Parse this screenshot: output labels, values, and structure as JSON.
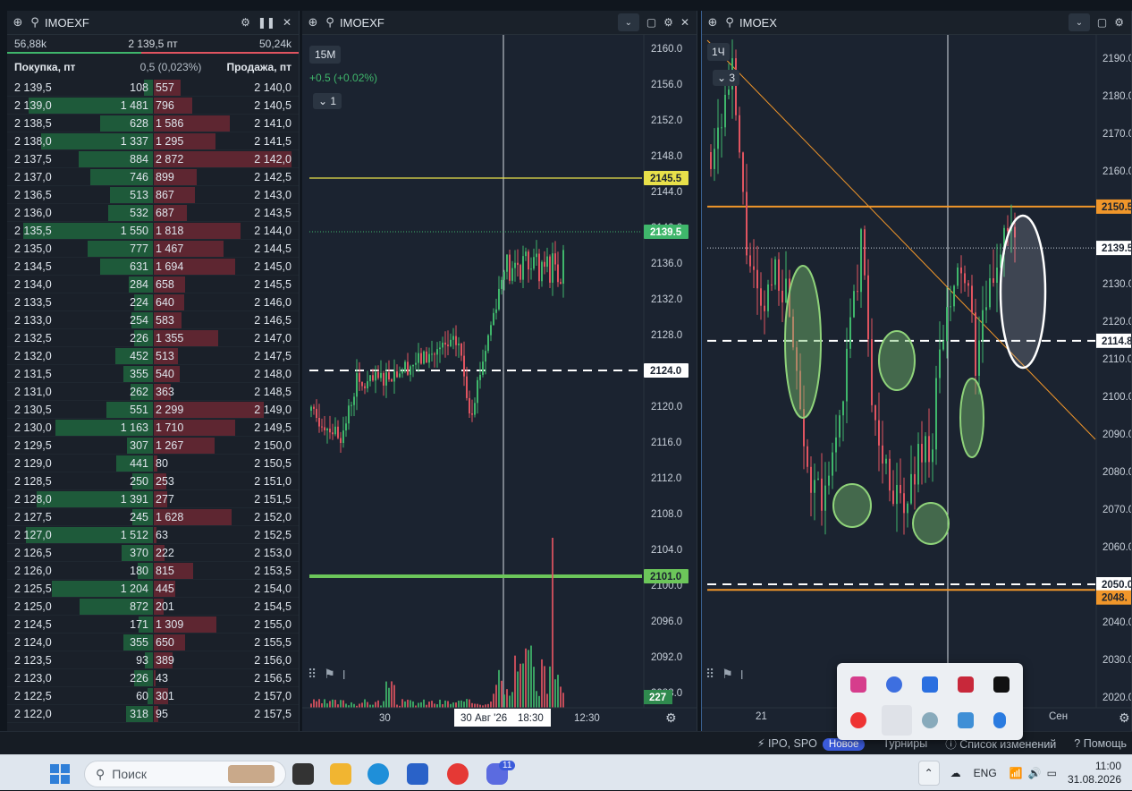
{
  "orderbook": {
    "symbol": "IMOEXF",
    "buy_volume": "56,88k",
    "mid_price": "2 139,5 пт",
    "sell_volume": "50,24k",
    "buy_header": "Покупка, пт",
    "spread": "0,5 (0,023%)",
    "sell_header": "Продажа, пт",
    "rows": [
      [
        "2 139,5",
        "108",
        "557",
        "2 140,0"
      ],
      [
        "2 139,0",
        "1 481",
        "796",
        "2 140,5"
      ],
      [
        "2 138,5",
        "628",
        "1 586",
        "2 141,0"
      ],
      [
        "2 138,0",
        "1 337",
        "1 295",
        "2 141,5"
      ],
      [
        "2 137,5",
        "884",
        "2 872",
        "2 142,0"
      ],
      [
        "2 137,0",
        "746",
        "899",
        "2 142,5"
      ],
      [
        "2 136,5",
        "513",
        "867",
        "2 143,0"
      ],
      [
        "2 136,0",
        "532",
        "687",
        "2 143,5"
      ],
      [
        "2 135,5",
        "1 550",
        "1 818",
        "2 144,0"
      ],
      [
        "2 135,0",
        "777",
        "1 467",
        "2 144,5"
      ],
      [
        "2 134,5",
        "631",
        "1 694",
        "2 145,0"
      ],
      [
        "2 134,0",
        "284",
        "658",
        "2 145,5"
      ],
      [
        "2 133,5",
        "224",
        "640",
        "2 146,0"
      ],
      [
        "2 133,0",
        "254",
        "583",
        "2 146,5"
      ],
      [
        "2 132,5",
        "226",
        "1 355",
        "2 147,0"
      ],
      [
        "2 132,0",
        "452",
        "513",
        "2 147,5"
      ],
      [
        "2 131,5",
        "355",
        "540",
        "2 148,0"
      ],
      [
        "2 131,0",
        "262",
        "363",
        "2 148,5"
      ],
      [
        "2 130,5",
        "551",
        "2 299",
        "2 149,0"
      ],
      [
        "2 130,0",
        "1 163",
        "1 710",
        "2 149,5"
      ],
      [
        "2 129,5",
        "307",
        "1 267",
        "2 150,0"
      ],
      [
        "2 129,0",
        "441",
        "80",
        "2 150,5"
      ],
      [
        "2 128,5",
        "250",
        "253",
        "2 151,0"
      ],
      [
        "2 128,0",
        "1 391",
        "277",
        "2 151,5"
      ],
      [
        "2 127,5",
        "245",
        "1 628",
        "2 152,0"
      ],
      [
        "2 127,0",
        "1 512",
        "63",
        "2 152,5"
      ],
      [
        "2 126,5",
        "370",
        "222",
        "2 153,0"
      ],
      [
        "2 126,0",
        "180",
        "815",
        "2 153,5"
      ],
      [
        "2 125,5",
        "1 204",
        "445",
        "2 154,0"
      ],
      [
        "2 125,0",
        "872",
        "201",
        "2 154,5"
      ],
      [
        "2 124,5",
        "171",
        "1 309",
        "2 155,0"
      ],
      [
        "2 124,0",
        "355",
        "650",
        "2 155,5"
      ],
      [
        "2 123,5",
        "93",
        "389",
        "2 156,0"
      ],
      [
        "2 123,0",
        "226",
        "43",
        "2 156,5"
      ],
      [
        "2 122,5",
        "60",
        "301",
        "2 157,0"
      ],
      [
        "2 122,0",
        "318",
        "95",
        "2 157,5"
      ]
    ]
  },
  "chart1": {
    "symbol": "IMOEXF",
    "timeframe": "15М",
    "change": "+0.5 (+0.02%)",
    "layers": "1",
    "y_ticks": [
      "2160.0",
      "2156.0",
      "2152.0",
      "2148.0",
      "2144.0",
      "2140.0",
      "2136.0",
      "2132.0",
      "2128.0",
      "2124.0",
      "2120.0",
      "2116.0",
      "2112.0",
      "2108.0",
      "2104.0",
      "2100.0",
      "2096.0",
      "2092.0",
      "2088.0"
    ],
    "marker_yellow": "2145.5",
    "marker_last": "2139.5",
    "marker_dashed": "2124.0",
    "marker_green": "2101.0",
    "marker_volume": "227",
    "x_labels": [
      "30",
      "12:30"
    ],
    "crosshair_date": "30 Авг '26",
    "crosshair_time": "18:30",
    "colors": {
      "up": "#3fb66b",
      "down": "#e05460",
      "yellow": "#e8e04a",
      "green_line": "#6cc65a"
    }
  },
  "chart2": {
    "symbol": "IMOEX",
    "timeframe": "1Ч",
    "layers": "3",
    "y_ticks": [
      "2190.0",
      "2180.0",
      "2170.0",
      "2160.0",
      "2150.0",
      "2140.0",
      "2130.0",
      "2120.0",
      "2110.0",
      "2100.0",
      "2090.0",
      "2080.0",
      "2070.0",
      "2060.0",
      "2050.0",
      "2040.0",
      "2030.0",
      "2020.0"
    ],
    "marker_orange_top": "2150.5",
    "marker_last": "2139.5",
    "marker_dashed_top": "2114.8",
    "marker_dashed_bottom": "2050.0",
    "marker_orange_bottom": "2048.",
    "x_labels": [
      "21",
      "Сен"
    ],
    "colors": {
      "orange": "#f0962a"
    }
  },
  "statusbar": {
    "ipo": "IPO, SPO",
    "ipo_badge": "Новое",
    "tournaments": "Турниры",
    "changelog": "Список изменений",
    "help": "Помощь"
  },
  "taskbar": {
    "search_placeholder": "Поиск",
    "chat_badge": "11",
    "lang": "ENG",
    "time": "11:00",
    "date": "31.08.2026"
  }
}
